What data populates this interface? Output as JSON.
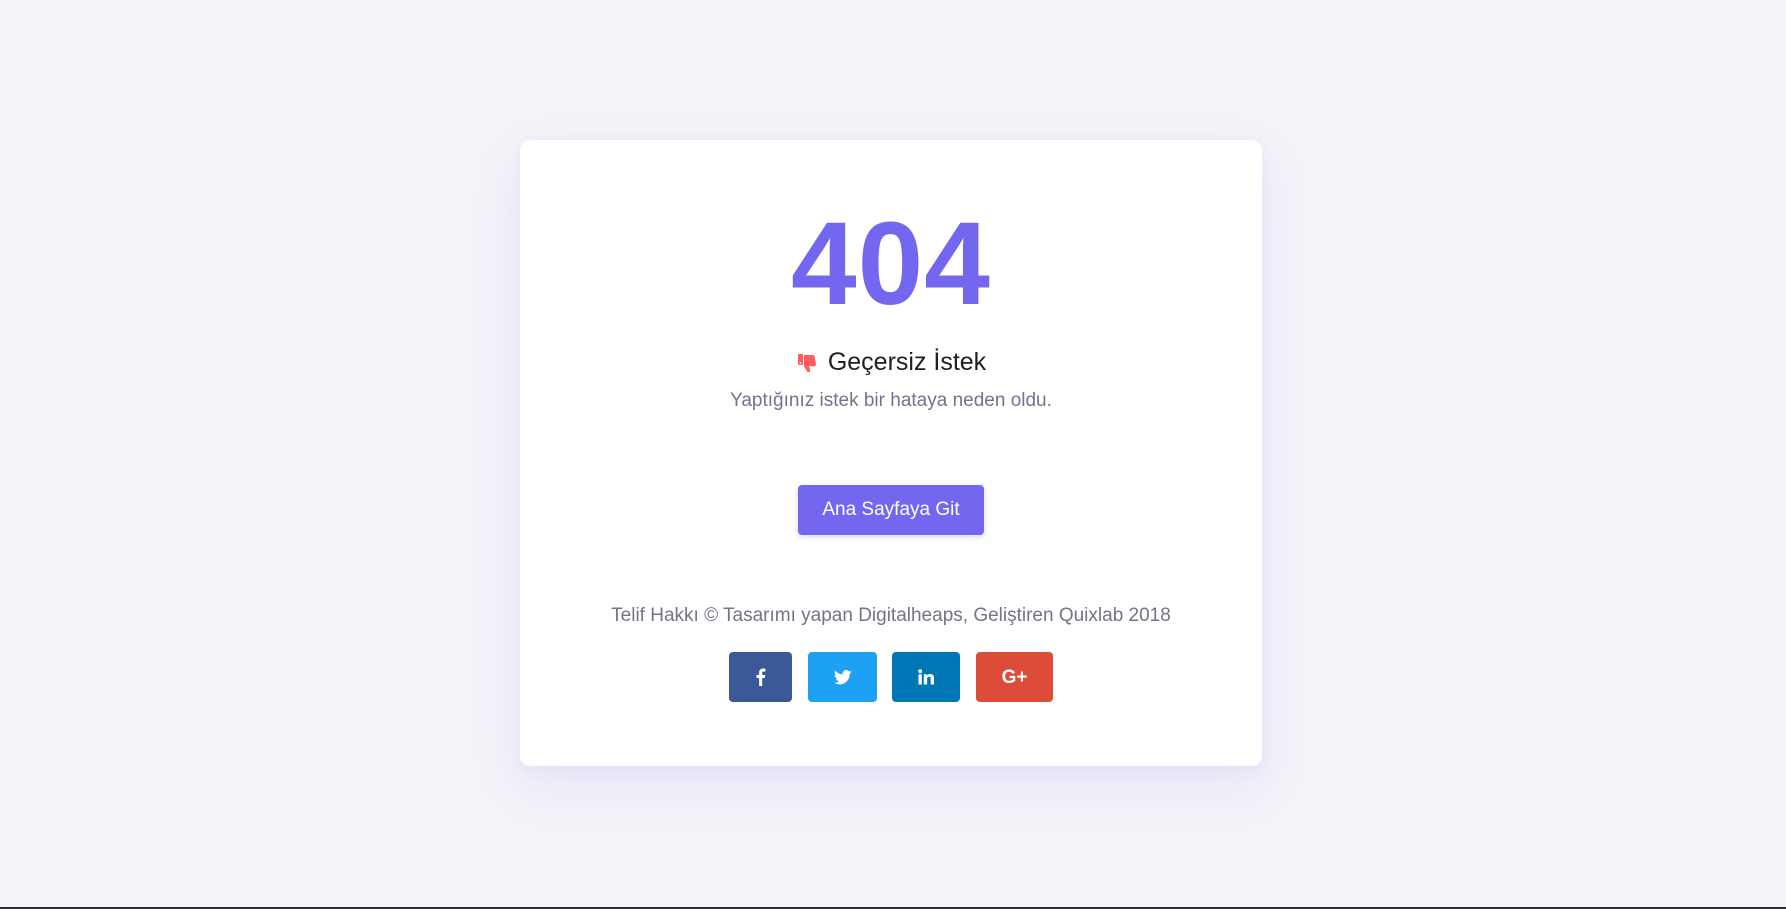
{
  "error": {
    "code": "404",
    "title": "Geçersiz İstek",
    "title_icon": "thumbs-down-icon",
    "message": "Yaptığınız istek bir hataya neden oldu."
  },
  "actions": {
    "home_label": "Ana Sayfaya Git"
  },
  "footer": {
    "copyright": "Telif Hakkı © Tasarımı yapan Digitalheaps, Geliştiren Quixlab 2018"
  },
  "social": {
    "facebook": {
      "icon": "facebook-icon",
      "color": "#3b5998"
    },
    "twitter": {
      "icon": "twitter-icon",
      "color": "#1da1f2"
    },
    "linkedin": {
      "icon": "linkedin-icon",
      "color": "#0077b5"
    },
    "googleplus": {
      "icon": "google-plus-icon",
      "label": "G+",
      "color": "#dd4b39"
    }
  },
  "theme": {
    "accent": "#7367f0",
    "background": "#f3f3f9",
    "icon_red": "#ff5e5e"
  }
}
